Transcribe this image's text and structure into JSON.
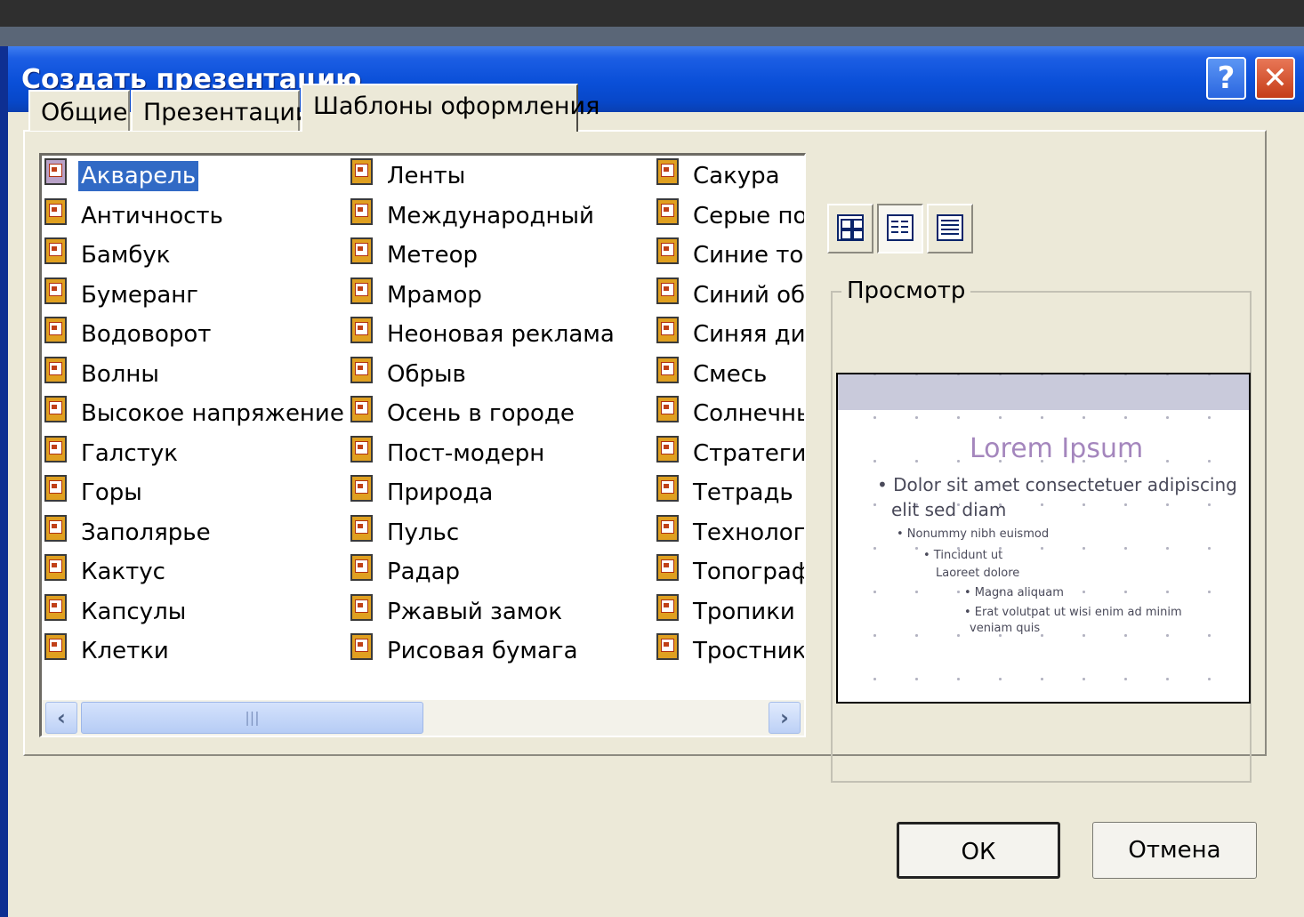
{
  "window": {
    "title": "Создать презентацию",
    "help_label": "?",
    "close_label": "✕"
  },
  "tabs": [
    {
      "label": "Общие",
      "active": false
    },
    {
      "label": "Презентации",
      "active": false
    },
    {
      "label": "Шаблоны оформления",
      "active": true
    }
  ],
  "templates": {
    "selected": "Акварель",
    "columns": [
      [
        "Акварель",
        "Античность",
        "Бамбук",
        "Бумеранг",
        "Водоворот",
        "Волны",
        "Высокое напряжение",
        "Галстук",
        "Горы",
        "Заполярье",
        "Кактус",
        "Капсулы",
        "Клетки"
      ],
      [
        "Ленты",
        "Международный",
        "Метеор",
        "Мрамор",
        "Неоновая реклама",
        "Обрыв",
        "Осень в городе",
        "Пост-модерн",
        "Природа",
        "Пульс",
        "Радар",
        "Ржавый замок",
        "Рисовая бумага"
      ],
      [
        "Сакура",
        "Серые пол",
        "Синие тон",
        "Синий обе",
        "Синяя диа",
        "Смесь",
        "Солнечны",
        "Стратегия",
        "Тетрадь",
        "Технологи",
        "Топографи",
        "Тропики",
        "Тростник"
      ]
    ],
    "item_icon": "presentation-template-icon"
  },
  "scrollbar": {
    "left_arrow": "‹",
    "right_arrow": "›",
    "grip": "|||"
  },
  "view_buttons": [
    "large-icons-view-icon",
    "list-view-icon",
    "details-view-icon"
  ],
  "preview": {
    "label": "Просмотр",
    "slide_title": "Lorem Ipsum",
    "slide_line1": "• Dolor sit amet consectetuer adipiscing",
    "slide_line2": "elit sed diam",
    "slide_small1": "• Nonummy nibh euismod",
    "slide_small2": "• Tincidunt ut",
    "slide_small3": "Laoreet dolore",
    "slide_small4": "• Magna aliquam",
    "slide_small5": "• Erat volutpat ut wisi enim ad minim",
    "slide_small6": "veniam quis"
  },
  "buttons": {
    "ok": "ОК",
    "cancel": "Отмена"
  }
}
